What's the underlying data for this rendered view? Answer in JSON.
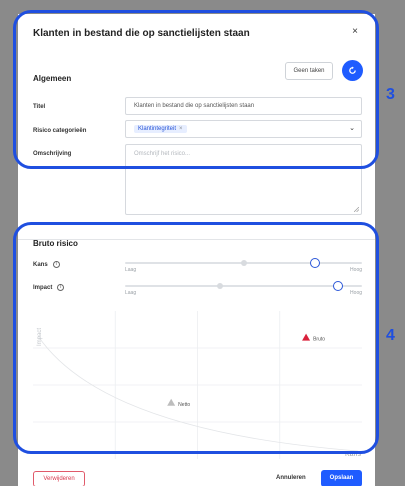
{
  "modal": {
    "title": "Klanten in bestand die op sanctielijsten staan",
    "close_glyph": "×",
    "tasks_button": "Geen taken",
    "action_icon": "refresh-icon"
  },
  "general": {
    "section_title": "Algemeen",
    "title_label": "Titel",
    "title_value": "Klanten in bestand die op sanctielijsten staan",
    "category_label": "Risico categorieën",
    "category_tag": "Klantintegriteit",
    "tag_remove": "×",
    "description_label": "Omschrijving",
    "description_placeholder": "Omschrijf het risico..."
  },
  "gross_risk": {
    "section_title": "Bruto risico",
    "kans_label": "Kans",
    "impact_label": "Impact",
    "info_glyph": "i",
    "low_label": "Laag",
    "high_label": "Hoog",
    "kans_level": 0.8,
    "impact_level": 0.9
  },
  "chart_data": {
    "type": "scatter",
    "ylabel": "Impact",
    "xlabel": "Kans",
    "points": [
      {
        "name": "Bruto",
        "x": 0.83,
        "y": 0.82,
        "color": "#d9213b"
      },
      {
        "name": "Netto",
        "x": 0.42,
        "y": 0.38,
        "color": "#bdbdbd"
      }
    ]
  },
  "footer": {
    "delete_label": "Verwijderen",
    "cancel_label": "Annuleren",
    "save_label": "Opslaan"
  },
  "callouts": {
    "top": "3",
    "bottom": "4"
  },
  "colors": {
    "accent": "#1f5cff",
    "highlight": "#1f4fe0",
    "danger": "#d83a4e"
  }
}
